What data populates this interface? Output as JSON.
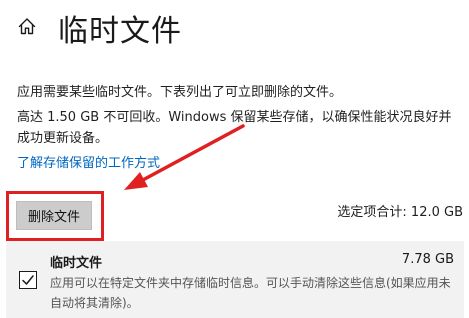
{
  "header": {
    "title": "临时文件",
    "home_icon": "home-icon"
  },
  "content": {
    "intro": "应用需要某些临时文件。下表列出了可立即删除的文件。",
    "note": "高达 1.50 GB 不可回收。Windows 保留某些存储，以确保性能状况良好并成功更新设备。",
    "link_text": "了解存储保留的工作方式",
    "delete_button": "删除文件",
    "selected_total": "选定项合计: 12.0 GB"
  },
  "items": [
    {
      "title": "临时文件",
      "size": "7.78 GB",
      "description": "应用可以在特定文件夹中存储临时信息。可以手动清除这些信息(如果应用未自动将其清除)。",
      "checked": true
    }
  ],
  "colors": {
    "link": "#0067c0",
    "annotation_red": "#e02020",
    "button_bg": "#cccccc",
    "row_bg": "#f2f2f2"
  }
}
